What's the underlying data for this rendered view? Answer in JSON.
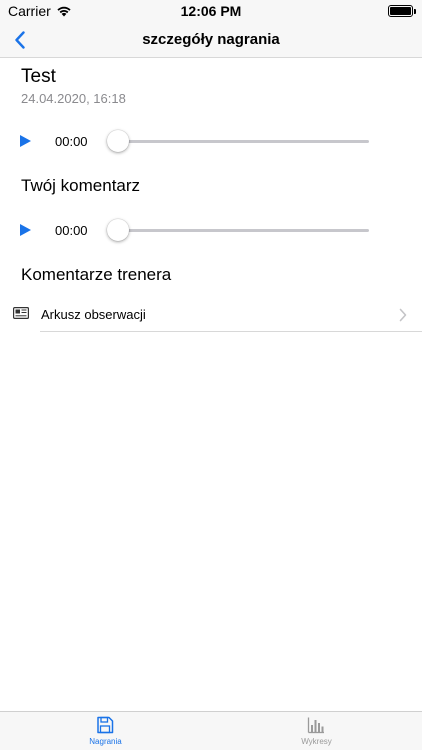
{
  "status_bar": {
    "carrier": "Carrier",
    "time": "12:06 PM"
  },
  "nav": {
    "title": "szczegóły nagrania",
    "back_icon": "chevron-left-icon"
  },
  "recording": {
    "title": "Test",
    "date": "24.04.2020, 16:18"
  },
  "players": {
    "main": {
      "time": "00:00",
      "progress": 0
    },
    "comment": {
      "time": "00:00",
      "progress": 0
    }
  },
  "sections": {
    "your_comment": "Twój komentarz",
    "trainer_comments": "Komentarze trenera"
  },
  "list": {
    "items": [
      {
        "label": "Arkusz obserwacji",
        "icon": "newspaper-icon"
      }
    ]
  },
  "tabs": [
    {
      "label": "Nagrania",
      "icon": "floppy-disk-icon",
      "active": true
    },
    {
      "label": "Wykresy",
      "icon": "bar-chart-icon",
      "active": false
    }
  ],
  "colors": {
    "accent": "#1a73e8",
    "inactive": "#9a9a9a",
    "secondary_text": "#8a8a8e",
    "bar_background": "#f7f7f7"
  }
}
